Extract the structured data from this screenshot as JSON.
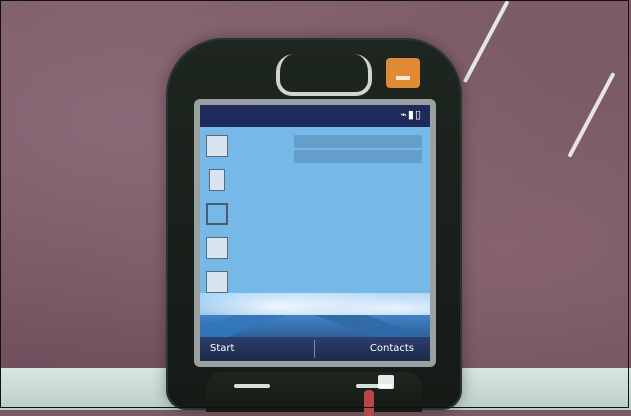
{
  "phone": {
    "softkeys": {
      "left": "Start",
      "right": "Contacts"
    },
    "colors": {
      "body": "#1e2620",
      "screen": "#76b8e8",
      "status_bar": "#1d2a5a",
      "brand_badge": "#e08a35"
    }
  }
}
